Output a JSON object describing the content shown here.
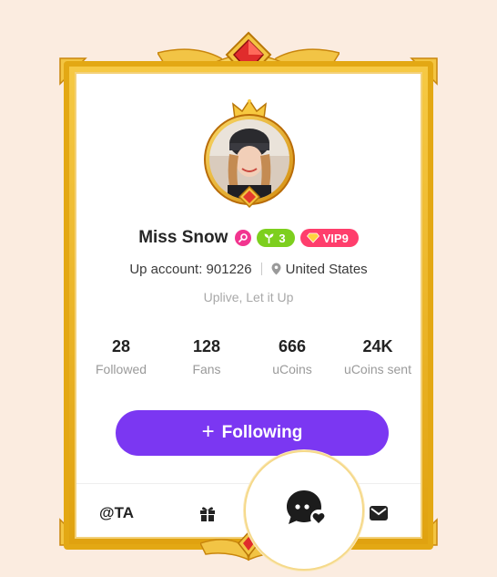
{
  "profile": {
    "name": "Miss Snow",
    "level_badge": "3",
    "vip_badge": "VIP9",
    "account_label": "Up account: 901226",
    "location": "United States",
    "bio": "Uplive, Let it Up"
  },
  "stats": [
    {
      "value": "28",
      "label": "Followed"
    },
    {
      "value": "128",
      "label": "Fans"
    },
    {
      "value": "666",
      "label": "uCoins"
    },
    {
      "value": "24K",
      "label": "uCoins sent"
    }
  ],
  "actions": {
    "follow_label": "Following",
    "follow_icon": "+",
    "mention_label": "@TA"
  },
  "icons": {
    "gift": "gift-icon",
    "chat": "chat-heart-icon",
    "mail": "mail-icon",
    "location": "location-pin-icon"
  },
  "colors": {
    "accent": "#7b37f2",
    "gold": "#e3a814",
    "level_green": "#7dcf1e",
    "vip_red": "#ff3e6c",
    "badge_pink": "#f2358f"
  }
}
